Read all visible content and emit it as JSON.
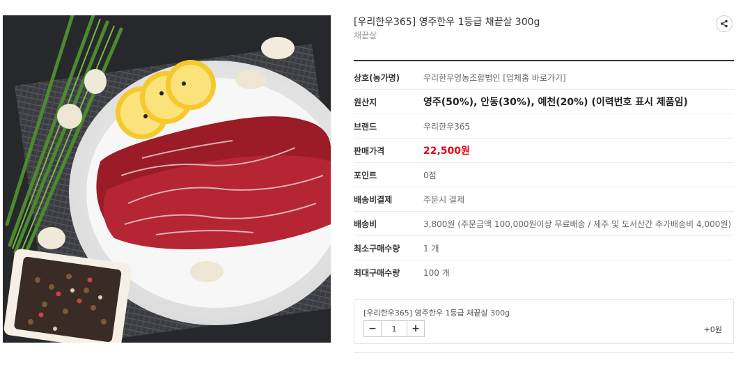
{
  "product": {
    "title": "[우리한우365] 영주한우 1등급 채끝살 300g",
    "subtitle": "채끝살",
    "image_icon": "product-photo-beef-steak"
  },
  "share": {
    "icon": "share-icon"
  },
  "info_rows": [
    {
      "label": "상호(농가명)",
      "value": "우리한우영농조합법인 [업체홈 바로가기]",
      "style": "normal"
    },
    {
      "label": "원산지",
      "value": "영주(50%), 안동(30%), 예천(20%) (이력번호 표시 제품임)",
      "style": "big"
    },
    {
      "label": "브랜드",
      "value": "우리한우365",
      "style": "normal"
    },
    {
      "label": "판매가격",
      "value": "22,500원",
      "style": "price"
    },
    {
      "label": "포인트",
      "value": "0점",
      "style": "normal"
    },
    {
      "label": "배송비결제",
      "value": "주문시 결제",
      "style": "normal"
    },
    {
      "label": "배송비",
      "value": "3,800원 (주문금액 100,000원이상 무료배송 / 제주 및 도서산간 추가배송비 4,000원)",
      "style": "normal"
    },
    {
      "label": "최소구매수량",
      "value": "1 개",
      "style": "normal"
    },
    {
      "label": "최대구매수량",
      "value": "100 개",
      "style": "normal"
    }
  ],
  "option": {
    "name": "[우리한우365] 영주한우 1등급 채끝살 300g",
    "minus_label": "−",
    "quantity": "1",
    "plus_label": "+",
    "price": "+0원"
  },
  "colors": {
    "price": "#e60012",
    "rule": "#333333",
    "border": "#e5e5e5"
  }
}
